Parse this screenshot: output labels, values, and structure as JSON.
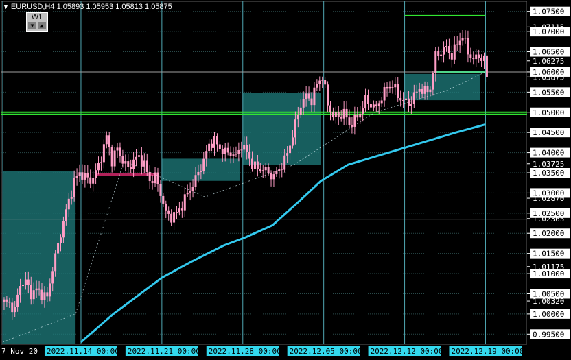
{
  "header": {
    "symbol_tf": "EURUSD,H4",
    "ohlc": "1.05893 1.05953 1.05813 1.05875"
  },
  "window_button": {
    "label": "W1",
    "down_icon": "triangle-down-icon",
    "up_icon": "triangle-up-icon"
  },
  "colors": {
    "background": "#000000",
    "grid": "#2a4a4a",
    "candle": "#ff9ec6",
    "ma": "#33c9ee",
    "green_line": "#32e632",
    "box": "#1f7e7e",
    "vline": "#4fa7b3",
    "axis_text": "#ffffff",
    "price_tag_bg": "#ffffff",
    "time_tag_bg": "#33d9ee"
  },
  "chart_data": {
    "type": "candlestick",
    "symbol": "EURUSD",
    "timeframe": "H4",
    "ylim": [
      0.9925,
      1.0775
    ],
    "y_ticks": [
      "1.07500",
      "1.07115",
      "1.07000",
      "1.06500",
      "1.06275",
      "1.06000",
      "1.05875",
      "1.05500",
      "1.05000",
      "1.04500",
      "1.04000",
      "1.03725",
      "1.03500",
      "1.03000",
      "1.02870",
      "1.02500",
      "1.02365",
      "1.02000",
      "1.01500",
      "1.01175",
      "1.01000",
      "1.00500",
      "1.00320",
      "1.00000",
      "0.99500"
    ],
    "x_ticks": [
      {
        "label": "7 Nov 20",
        "bar": 0
      },
      {
        "label": "2022.11.14 00:00",
        "bar": 29
      },
      {
        "label": "2022.11.21 00:00",
        "bar": 59
      },
      {
        "label": "2022.11.28 00:00",
        "bar": 89
      },
      {
        "label": "2022.12.05 00:00",
        "bar": 119
      },
      {
        "label": "2022.12.12 00:00",
        "bar": 149
      },
      {
        "label": "2022.12.19 00:00",
        "bar": 179
      }
    ],
    "last_price": 1.05875,
    "anchors": [
      [
        0,
        1.003
      ],
      [
        2,
        1.0025
      ],
      [
        4,
        1.001
      ],
      [
        6,
        1.0075
      ],
      [
        8,
        1.008
      ],
      [
        10,
        1.005
      ],
      [
        12,
        1.006
      ],
      [
        14,
        1.005
      ],
      [
        16,
        1.004
      ],
      [
        18,
        1.0115
      ],
      [
        20,
        1.017
      ],
      [
        22,
        1.023
      ],
      [
        24,
        1.028
      ],
      [
        26,
        1.033
      ],
      [
        28,
        1.035
      ],
      [
        30,
        1.034
      ],
      [
        32,
        1.033
      ],
      [
        34,
        1.035
      ],
      [
        36,
        1.039
      ],
      [
        38,
        1.044
      ],
      [
        40,
        1.038
      ],
      [
        42,
        1.041
      ],
      [
        44,
        1.038
      ],
      [
        46,
        1.036
      ],
      [
        48,
        1.038
      ],
      [
        50,
        1.039
      ],
      [
        52,
        1.037
      ],
      [
        54,
        1.033
      ],
      [
        56,
        1.034
      ],
      [
        58,
        1.03
      ],
      [
        60,
        1.025
      ],
      [
        62,
        1.024
      ],
      [
        64,
        1.025
      ],
      [
        66,
        1.027
      ],
      [
        68,
        1.03
      ],
      [
        70,
        1.032
      ],
      [
        72,
        1.035
      ],
      [
        74,
        1.038
      ],
      [
        76,
        1.042
      ],
      [
        78,
        1.043
      ],
      [
        80,
        1.041
      ],
      [
        82,
        1.04
      ],
      [
        84,
        1.04
      ],
      [
        86,
        1.039
      ],
      [
        88,
        1.042
      ],
      [
        90,
        1.04
      ],
      [
        92,
        1.037
      ],
      [
        94,
        1.036
      ],
      [
        96,
        1.036
      ],
      [
        98,
        1.035
      ],
      [
        100,
        1.034
      ],
      [
        102,
        1.036
      ],
      [
        104,
        1.038
      ],
      [
        106,
        1.042
      ],
      [
        108,
        1.047
      ],
      [
        110,
        1.052
      ],
      [
        112,
        1.054
      ],
      [
        114,
        1.053
      ],
      [
        116,
        1.057
      ],
      [
        118,
        1.059
      ],
      [
        120,
        1.052
      ],
      [
        122,
        1.049
      ],
      [
        124,
        1.049
      ],
      [
        126,
        1.05
      ],
      [
        128,
        1.047
      ],
      [
        130,
        1.048
      ],
      [
        132,
        1.05
      ],
      [
        134,
        1.053
      ],
      [
        136,
        1.052
      ],
      [
        138,
        1.051
      ],
      [
        140,
        1.054
      ],
      [
        142,
        1.056
      ],
      [
        144,
        1.057
      ],
      [
        146,
        1.054
      ],
      [
        148,
        1.053
      ],
      [
        150,
        1.052
      ],
      [
        152,
        1.054
      ],
      [
        154,
        1.056
      ],
      [
        156,
        1.055
      ],
      [
        158,
        1.056
      ],
      [
        160,
        1.064
      ],
      [
        162,
        1.065
      ],
      [
        164,
        1.066
      ],
      [
        166,
        1.064
      ],
      [
        168,
        1.067
      ],
      [
        170,
        1.069
      ],
      [
        172,
        1.065
      ],
      [
        174,
        1.063
      ],
      [
        176,
        1.064
      ],
      [
        178,
        1.063
      ],
      [
        179,
        1.0588
      ]
    ],
    "moving_average": [
      [
        29,
        0.993
      ],
      [
        41,
        1.0
      ],
      [
        59,
        1.009
      ],
      [
        70,
        1.013
      ],
      [
        82,
        1.017
      ],
      [
        90,
        1.019
      ],
      [
        100,
        1.022
      ],
      [
        110,
        1.028
      ],
      [
        118,
        1.033
      ],
      [
        128,
        1.037
      ],
      [
        138,
        1.039
      ],
      [
        148,
        1.041
      ],
      [
        158,
        1.043
      ],
      [
        168,
        1.045
      ],
      [
        179,
        1.047
      ]
    ],
    "vertical_lines_bars": [
      0,
      29,
      59,
      89,
      119,
      149,
      179
    ],
    "green_lines": [
      {
        "price": 1.05
      },
      {
        "price": 1.0495
      },
      {
        "price": 1.074,
        "from_bar": 149,
        "to_bar": 179
      }
    ],
    "horizontal_lines": [
      {
        "price": 1.0235
      },
      {
        "price": 1.06
      }
    ],
    "short_lines": [
      {
        "price": 1.0345,
        "from_bar": 35,
        "to_bar": 58,
        "color": "#b2225a"
      },
      {
        "price": 1.06,
        "from_bar": 160,
        "to_bar": 179,
        "color": "#4fd58a"
      }
    ],
    "boxes": [
      {
        "from_bar": 0,
        "to_bar": 27,
        "top": 1.0355,
        "bottom": 0.9925
      },
      {
        "from_bar": 59,
        "to_bar": 88,
        "top": 1.0385,
        "bottom": 1.033
      },
      {
        "from_bar": 89,
        "to_bar": 118,
        "top": 1.0548,
        "bottom": 1.037
      },
      {
        "from_bar": 149,
        "to_bar": 177,
        "top": 1.0595,
        "bottom": 1.053
      }
    ],
    "trend_dots": [
      [
        0,
        0.993
      ],
      [
        27,
        1.0
      ],
      [
        45,
        1.038
      ],
      [
        75,
        1.029
      ],
      [
        108,
        1.037
      ],
      [
        138,
        1.05
      ],
      [
        165,
        1.0555
      ],
      [
        179,
        1.06
      ]
    ]
  }
}
